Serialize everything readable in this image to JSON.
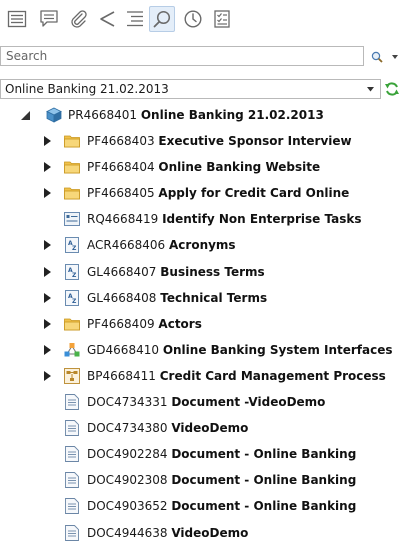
{
  "toolbar": {
    "buttons": [
      {
        "name": "list-view",
        "icon": "list-icon"
      },
      {
        "name": "comments",
        "icon": "comment-icon"
      },
      {
        "name": "attachments",
        "icon": "paperclip-icon"
      },
      {
        "name": "share",
        "icon": "share-icon"
      },
      {
        "name": "outline",
        "icon": "outline-icon"
      },
      {
        "name": "search",
        "icon": "search-icon",
        "active": true
      },
      {
        "name": "history",
        "icon": "clock-icon"
      },
      {
        "name": "checklist",
        "icon": "checklist-icon"
      }
    ]
  },
  "search": {
    "placeholder": "Search"
  },
  "project_select": {
    "selected": "Online Banking 21.02.2013"
  },
  "tree": {
    "root": {
      "id": "PR4668401",
      "name": "Online Banking 21.02.2013",
      "icon": "project-cube-icon",
      "expanded": true
    },
    "children": [
      {
        "id": "PF4668403",
        "name": "Executive Sponsor Interview",
        "icon": "folder-icon",
        "expandable": true
      },
      {
        "id": "PF4668404",
        "name": "Online Banking Website",
        "icon": "folder-icon",
        "expandable": true
      },
      {
        "id": "PF4668405",
        "name": "Apply for Credit Card Online",
        "icon": "folder-icon",
        "expandable": true
      },
      {
        "id": "RQ4668419",
        "name": "Identify Non Enterprise Tasks",
        "icon": "requirement-icon",
        "expandable": false
      },
      {
        "id": "ACR4668406",
        "name": "Acronyms",
        "icon": "glossary-icon",
        "expandable": true
      },
      {
        "id": "GL4668407",
        "name": "Business Terms",
        "icon": "glossary-icon",
        "expandable": true
      },
      {
        "id": "GL4668408",
        "name": "Technical Terms",
        "icon": "glossary-icon",
        "expandable": true
      },
      {
        "id": "PF4668409",
        "name": "Actors",
        "icon": "folder-icon",
        "expandable": true
      },
      {
        "id": "GD4668410",
        "name": "Online Banking System Interfaces",
        "icon": "diagram-icon",
        "expandable": true
      },
      {
        "id": "BP4668411",
        "name": "Credit Card Management Process",
        "icon": "process-icon",
        "expandable": true
      },
      {
        "id": "DOC4734331",
        "name": "Document -VideoDemo",
        "icon": "document-icon",
        "expandable": false
      },
      {
        "id": "DOC4734380",
        "name": "VideoDemo",
        "icon": "document-icon",
        "expandable": false
      },
      {
        "id": "DOC4902284",
        "name": "Document - Online Banking",
        "icon": "document-icon",
        "expandable": false
      },
      {
        "id": "DOC4902308",
        "name": "Document - Online Banking",
        "icon": "document-icon",
        "expandable": false
      },
      {
        "id": "DOC4903652",
        "name": "Document - Online Banking",
        "icon": "document-icon",
        "expandable": false
      },
      {
        "id": "DOC4944638",
        "name": "VideoDemo",
        "icon": "document-icon",
        "expandable": false
      }
    ]
  },
  "colors": {
    "folder": "#f0c14b",
    "project": "#4a90c8",
    "refresh": "#3aa33a",
    "toolbar_icon": "#6a6a6a"
  }
}
